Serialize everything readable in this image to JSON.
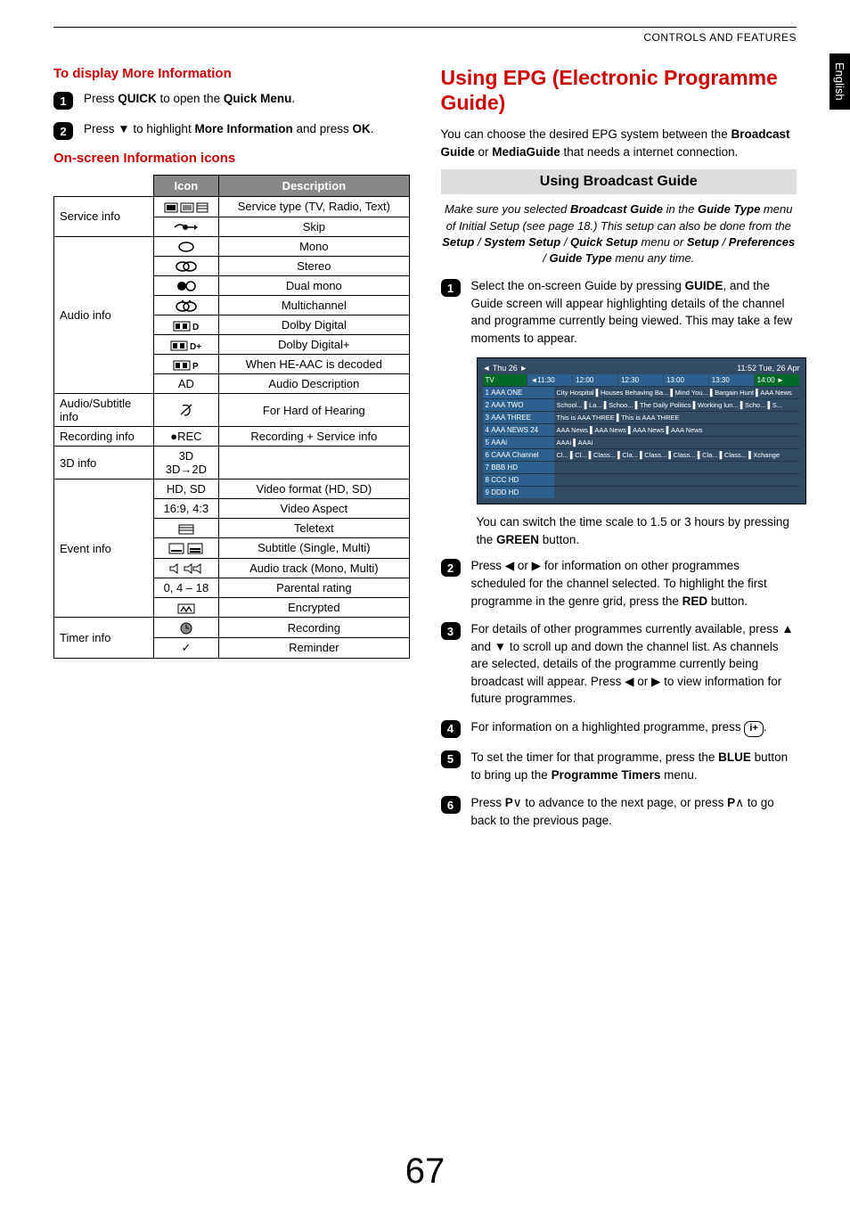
{
  "header": {
    "section": "CONTROLS AND FEATURES",
    "lang_tab": "English"
  },
  "page_number": "67",
  "left": {
    "h1": "To display More Information",
    "step1": "Press QUICK to open the Quick Menu.",
    "step2": "Press ▼ to highlight More Information and press OK.",
    "h2": "On-screen Information icons",
    "table": {
      "head_icon": "Icon",
      "head_desc": "Description",
      "rows": [
        {
          "cat": "Service info",
          "icon": "tv-teletext-bars",
          "desc": "Service type (TV, Radio, Text)"
        },
        {
          "cat": "",
          "icon": "skip-arrow",
          "desc": "Skip"
        },
        {
          "cat": "Audio info",
          "icon": "mono-oval",
          "desc": "Mono"
        },
        {
          "cat": "",
          "icon": "stereo-inf",
          "desc": "Stereo"
        },
        {
          "cat": "",
          "icon": "dual-mono",
          "desc": "Dual mono"
        },
        {
          "cat": "",
          "icon": "multichannel",
          "desc": "Multichannel"
        },
        {
          "cat": "",
          "icon": "dolby-d",
          "desc": "Dolby Digital"
        },
        {
          "cat": "",
          "icon": "dolby-dplus",
          "desc": "Dolby Digital+"
        },
        {
          "cat": "",
          "icon": "dolby-p",
          "desc": "When HE-AAC is decoded"
        },
        {
          "cat": "",
          "icon": "AD",
          "desc": "Audio Description"
        },
        {
          "cat": "Audio/Subtitle info",
          "icon": "ear",
          "desc": "For Hard of Hearing"
        },
        {
          "cat": "Recording info",
          "icon": "●REC",
          "desc": "Recording + Service info"
        },
        {
          "cat": "3D info",
          "icon": "3D  3D→2D",
          "desc": ""
        },
        {
          "cat": "Event info",
          "icon": "HD, SD",
          "desc": "Video format (HD, SD)"
        },
        {
          "cat": "",
          "icon": "16:9, 4:3",
          "desc": "Video Aspect"
        },
        {
          "cat": "",
          "icon": "teletext-bars",
          "desc": "Teletext"
        },
        {
          "cat": "",
          "icon": "subtitle-boxes",
          "desc": "Subtitle (Single, Multi)"
        },
        {
          "cat": "",
          "icon": "speaker-icons",
          "desc": "Audio track (Mono, Multi)"
        },
        {
          "cat": "",
          "icon": "0, 4 – 18",
          "desc": "Parental rating"
        },
        {
          "cat": "",
          "icon": "encrypted-m",
          "desc": "Encrypted"
        },
        {
          "cat": "Timer info",
          "icon": "clock",
          "desc": "Recording"
        },
        {
          "cat": "",
          "icon": "check",
          "desc": "Reminder"
        }
      ]
    }
  },
  "right": {
    "title": "Using EPG (Electronic Programme Guide)",
    "intro": "You can  choose the desired EPG system  between the Broadcast Guide or MediaGuide that needs a internet connection.",
    "sub_title": "Using  Broadcast Guide",
    "note": "Make sure you selected Broadcast Guide in the Guide Type menu of Initial Setup (see page 18.) This setup can also be done from the Setup / System Setup / Quick Setup menu or Setup / Preferences / Guide Type menu any time.",
    "step1": "Select the on-screen Guide by pressing GUIDE, and the Guide screen will appear highlighting details of the channel and programme currently being viewed. This may take a few moments to appear.",
    "epg": {
      "date_left": "◄ Thu 26 ►",
      "date_right": "11:52 Tue, 26 Apr",
      "tv": "TV",
      "times": [
        "◄11:30",
        "12:00",
        "12:30",
        "13:00",
        "13:30",
        "14:00 ►"
      ],
      "rows": [
        {
          "n": "1",
          "ch": "AAA ONE",
          "p": "City Hospital ▌Houses Behaving Ba... ▌Mind You... ▌Bargain Hunt      ▌AAA News"
        },
        {
          "n": "2",
          "ch": "AAA TWO",
          "p": "School... ▌La... ▌Schoo... ▌The Daily Politics               ▌Working lun... ▌Scho... ▌S..."
        },
        {
          "n": "3",
          "ch": "AAA THREE",
          "p": "This is AAA THREE                 ▌This is AAA THREE"
        },
        {
          "n": "4",
          "ch": "AAA NEWS 24",
          "p": "AAA News   ▌AAA News           ▌AAA News           ▌AAA News"
        },
        {
          "n": "5",
          "ch": "AAAi",
          "p": "AAAi                               ▌AAAi"
        },
        {
          "n": "6",
          "ch": "CAAA Channel",
          "p": "Cl... ▌Cl... ▌Class... ▌Cla... ▌Class... ▌Class... ▌Cla... ▌Class... ▌Xchange"
        },
        {
          "n": "7",
          "ch": "BBB HD",
          "p": ""
        },
        {
          "n": "8",
          "ch": "CCC HD",
          "p": ""
        },
        {
          "n": "9",
          "ch": "DDD HD",
          "p": ""
        }
      ]
    },
    "after_img": "You can switch the time scale to 1.5 or 3 hours by pressing the GREEN button.",
    "step2": "Press ◀ or ▶ for information on other programmes scheduled for the channel selected. To highlight the first programme in the genre grid, press the RED button.",
    "step3": "For details of other programmes currently available, press ▲ and ▼ to scroll up and down the channel list. As channels are selected, details of the programme currently being broadcast will appear. Press ◀ or ▶ to view information for future programmes.",
    "step4_a": "For information on a highlighted programme, press ",
    "step4_b": ".",
    "step5": "To set the timer for that programme, press the BLUE button to bring up the Programme Timers menu.",
    "step6": "Press P∨ to advance to the next page, or press P∧ to go back to the previous page."
  }
}
